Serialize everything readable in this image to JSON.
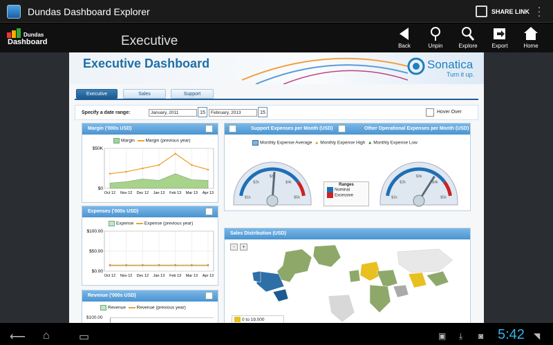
{
  "titlebar": {
    "title": "Dundas Dashboard Explorer",
    "share_label": "SHARE LINK"
  },
  "toolbar": {
    "logo_line1": "Dundas",
    "logo_line2": "Dashboard",
    "heading": "Executive",
    "buttons": [
      {
        "label": "Back",
        "icon": "back-arrow-icon"
      },
      {
        "label": "Unpin",
        "icon": "pin-icon"
      },
      {
        "label": "Explore",
        "icon": "search-icon"
      },
      {
        "label": "Export",
        "icon": "export-icon"
      },
      {
        "label": "Home",
        "icon": "home-icon"
      }
    ]
  },
  "dashboard": {
    "title": "Executive Dashboard",
    "brand": "Sonatica",
    "brand_tagline": "Turn it up.",
    "tabs": [
      "Executive",
      "Sales",
      "Support"
    ],
    "active_tab": "Executive",
    "date_label": "Specify a date range:",
    "date_from": "January, 2011",
    "date_to": "February, 2013",
    "cal_day": "15",
    "hover_label": "Hover Over"
  },
  "panels": {
    "margin": "Margin ('000s USD)",
    "expenses": "Expenses ('000s USD)",
    "revenue": "Revenue ('000s USD)",
    "support": "Support Expenses per Month (USD)",
    "other": "Other Operational Expenses per Month (USD)",
    "sales": "Sales Distribution (USD)"
  },
  "chart_data": [
    {
      "type": "area",
      "title": "Margin ('000s USD)",
      "categories": [
        "Oct 12",
        "Nov 12",
        "Dec 12",
        "Jan 13",
        "Feb 13",
        "Mar 13",
        "Apr 13"
      ],
      "series": [
        {
          "name": "Margin",
          "values": [
            8,
            10,
            14,
            12,
            22,
            13,
            12
          ]
        },
        {
          "name": "Margin (previous year)",
          "values": [
            22,
            25,
            30,
            35,
            52,
            35,
            28
          ]
        }
      ],
      "ytick_labels": [
        "$0",
        "$50K"
      ],
      "ylim": [
        0,
        60
      ]
    },
    {
      "type": "line",
      "title": "Expenses ('000s USD)",
      "categories": [
        "Oct 12",
        "Nov 12",
        "Dec 12",
        "Jan 13",
        "Feb 13",
        "Mar 13",
        "Apr 13"
      ],
      "series": [
        {
          "name": "Expense",
          "values": [
            15,
            15,
            15,
            15,
            15,
            15,
            15
          ]
        },
        {
          "name": "Expense (previous year)",
          "values": [
            14,
            14,
            14,
            14,
            14,
            14,
            14
          ]
        }
      ],
      "ytick_labels": [
        "$0.00",
        "$50.00",
        "$100.00"
      ],
      "ylim": [
        0,
        100
      ]
    },
    {
      "type": "line",
      "title": "Revenue ('000s USD)",
      "series": [
        {
          "name": "Revenue",
          "values": []
        },
        {
          "name": "Revenue (previous year)",
          "values": []
        }
      ],
      "ytick_labels": [
        "$100.00"
      ]
    }
  ],
  "gauges": {
    "legend": [
      "Monthly Expense Average",
      "Monthly Expense High",
      "Monthly Expense Low"
    ],
    "ranges_title": "Ranges",
    "ranges": [
      {
        "label": "Nominal",
        "color": "#1f6fb5"
      },
      {
        "label": "Excessive",
        "color": "#cc2222"
      }
    ],
    "ticks": [
      "$1k",
      "$2k",
      "$3k",
      "$4k",
      "$5k"
    ],
    "left_value": 3.1,
    "right_value": 3.8
  },
  "sales_map": {
    "zoom_out": "-",
    "zoom_in": "+",
    "legend_first": "0 to 19,000"
  },
  "statusbar": {
    "clock": "5:42"
  },
  "colors": {
    "accent": "#4a94d0",
    "header_blue": "#1f6fa6",
    "margin_fill": "#a8d38a",
    "prev_line": "#f0a030"
  }
}
